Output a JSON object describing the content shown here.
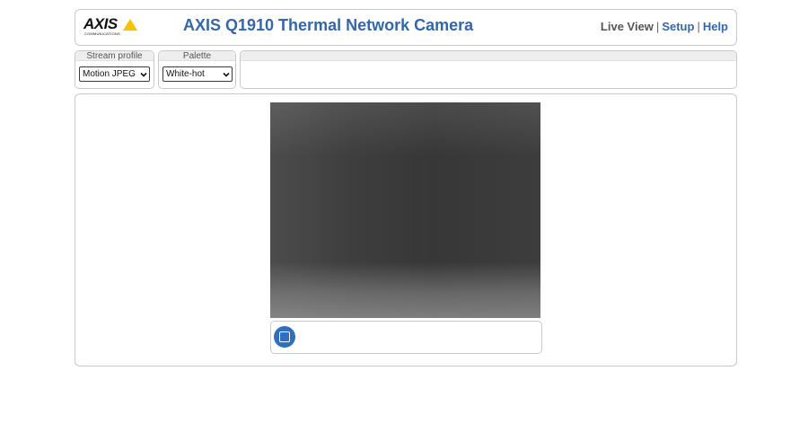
{
  "header": {
    "logo_text": "AXIS",
    "logo_subtext": "COMMUNICATIONS",
    "title": "AXIS Q1910 Thermal Network Camera",
    "nav": {
      "live_view": "Live View",
      "setup": "Setup",
      "help": "Help",
      "separator": "|"
    }
  },
  "controls": {
    "stream_profile": {
      "label": "Stream profile",
      "value": "Motion JPEG"
    },
    "palette": {
      "label": "Palette",
      "value": "White-hot"
    }
  },
  "player": {
    "stop_icon": "stop-icon"
  },
  "colors": {
    "brand_blue": "#3466a8",
    "logo_yellow": "#f5c400",
    "button_blue": "#2f6fbf"
  }
}
